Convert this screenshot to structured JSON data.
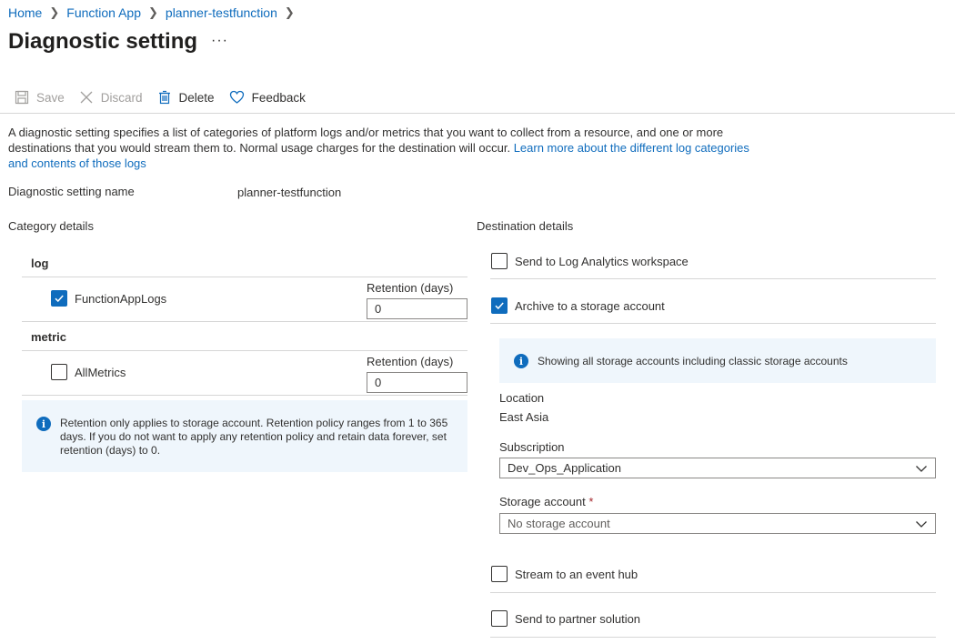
{
  "breadcrumb": {
    "items": [
      "Home",
      "Function App",
      "planner-testfunction"
    ]
  },
  "page": {
    "title": "Diagnostic setting",
    "more": "···"
  },
  "toolbar": {
    "save": "Save",
    "discard": "Discard",
    "delete": "Delete",
    "feedback": "Feedback"
  },
  "description": {
    "text": "A diagnostic setting specifies a list of categories of platform logs and/or metrics that you want to collect from a resource, and one or more destinations that you would stream them to. Normal usage charges for the destination will occur. ",
    "link": "Learn more about the different log categories and contents of those logs"
  },
  "setting_name": {
    "label": "Diagnostic setting name",
    "value": "planner-testfunction"
  },
  "category": {
    "heading": "Category details",
    "log": {
      "heading": "log",
      "item": "FunctionAppLogs",
      "checked": true,
      "retention_label": "Retention (days)",
      "retention_value": "0"
    },
    "metric": {
      "heading": "metric",
      "item": "AllMetrics",
      "checked": false,
      "retention_label": "Retention (days)",
      "retention_value": "0"
    },
    "info": "Retention only applies to storage account. Retention policy ranges from 1 to 365 days. If you do not want to apply any retention policy and retain data forever, set retention (days) to 0."
  },
  "destination": {
    "heading": "Destination details",
    "log_analytics": {
      "label": "Send to Log Analytics workspace",
      "checked": false
    },
    "archive": {
      "label": "Archive to a storage account",
      "checked": true
    },
    "storage_info": "Showing all storage accounts including classic storage accounts",
    "location": {
      "label": "Location",
      "value": "East Asia"
    },
    "subscription": {
      "label": "Subscription",
      "value": "Dev_Ops_Application"
    },
    "storage_account": {
      "label": "Storage account",
      "required": "*",
      "placeholder": "No storage account"
    },
    "event_hub": {
      "label": "Stream to an event hub",
      "checked": false
    },
    "partner": {
      "label": "Send to partner solution",
      "checked": false
    }
  },
  "colors": {
    "accent": "#0f6cbd",
    "info_bg": "#eff6fc",
    "divider": "#d6d6d6"
  }
}
